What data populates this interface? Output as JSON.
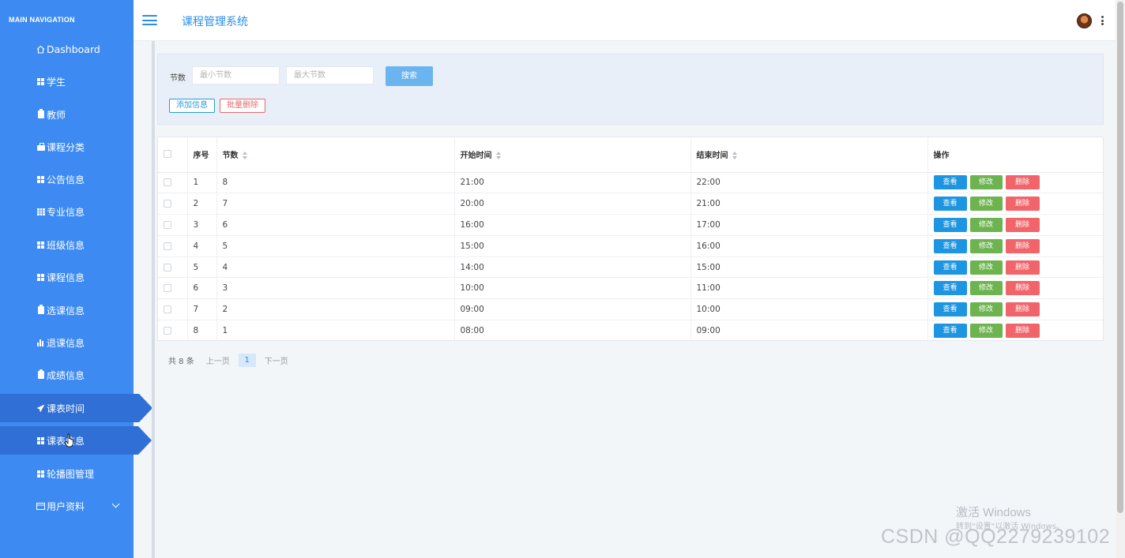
{
  "sidebar": {
    "heading": "MAIN NAVIGATION",
    "items": [
      {
        "label": "Dashboard",
        "icon": "home-icon"
      },
      {
        "label": "学生",
        "icon": "grid-icon"
      },
      {
        "label": "教师",
        "icon": "clipboard-icon"
      },
      {
        "label": "课程分类",
        "icon": "briefcase-icon"
      },
      {
        "label": "公告信息",
        "icon": "grid-icon"
      },
      {
        "label": "专业信息",
        "icon": "table-icon"
      },
      {
        "label": "班级信息",
        "icon": "grid-icon"
      },
      {
        "label": "课程信息",
        "icon": "grid-icon"
      },
      {
        "label": "选课信息",
        "icon": "clipboard-icon"
      },
      {
        "label": "退课信息",
        "icon": "bar-chart-icon"
      },
      {
        "label": "成绩信息",
        "icon": "clipboard-check-icon"
      },
      {
        "label": "课表时间",
        "icon": "paper-plane-icon",
        "active": true
      },
      {
        "label": "课表信息",
        "icon": "grid-icon",
        "active": true
      },
      {
        "label": "轮播图管理",
        "icon": "grid-icon"
      },
      {
        "label": "用户资料",
        "icon": "card-icon",
        "expandable": true
      }
    ]
  },
  "header": {
    "title": "课程管理系统",
    "menu_icon": "hamburger-icon",
    "avatar_icon": "avatar",
    "more_icon": "kebab-menu-icon"
  },
  "search": {
    "label": "节数",
    "min_placeholder": "最小节数",
    "max_placeholder": "最大节数",
    "search_button": "搜索",
    "add_button": "添加信息",
    "batch_delete_button": "批量删除"
  },
  "table": {
    "headers": {
      "index": "序号",
      "section": "节数",
      "start": "开始时间",
      "end": "结束时间",
      "actions": "操作"
    },
    "rows": [
      {
        "index": "1",
        "section": "8",
        "start": "21:00",
        "end": "22:00"
      },
      {
        "index": "2",
        "section": "7",
        "start": "20:00",
        "end": "21:00"
      },
      {
        "index": "3",
        "section": "6",
        "start": "16:00",
        "end": "17:00"
      },
      {
        "index": "4",
        "section": "5",
        "start": "15:00",
        "end": "16:00"
      },
      {
        "index": "5",
        "section": "4",
        "start": "14:00",
        "end": "15:00"
      },
      {
        "index": "6",
        "section": "3",
        "start": "10:00",
        "end": "11:00"
      },
      {
        "index": "7",
        "section": "2",
        "start": "09:00",
        "end": "10:00"
      },
      {
        "index": "8",
        "section": "1",
        "start": "08:00",
        "end": "09:00"
      }
    ],
    "row_actions": {
      "view": "查看",
      "edit": "修改",
      "delete": "删除"
    }
  },
  "pagination": {
    "total": "共 8 条",
    "prev": "上一页",
    "current": "1",
    "next": "下一页"
  },
  "watermark": {
    "activate_title": "激活 Windows",
    "activate_hint": "转到\"设置\"以激活 Windows。",
    "csdn": "CSDN @QQ2279239102"
  },
  "colors": {
    "sidebar_bg": "#3d8bf2",
    "sidebar_active": "#2f6fd6",
    "accent": "#2b8de8",
    "view_btn": "#1e95e0",
    "edit_btn": "#6db450",
    "delete_btn": "#f0646a"
  }
}
